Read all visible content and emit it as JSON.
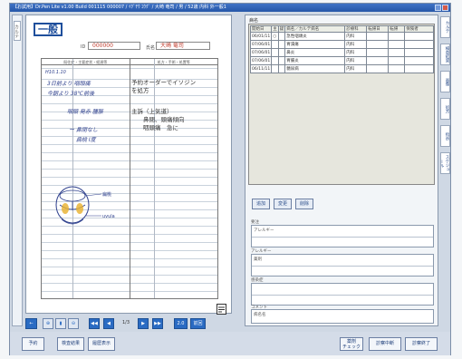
{
  "window": {
    "title": "【お試用】Dr.Pen Lite v1.00 Build 001115 000007 / ｲｸﾞﾁｳ ｺｳｸﾞ / 大崎 竜司 / 男 / 52歳 内科 外一般1"
  },
  "left_tab": {
    "label": "カルテ"
  },
  "chart": {
    "department": "一般",
    "patient_id_label": "ID",
    "patient_id": "000000",
    "name_label": "氏名",
    "patient_name": "大崎 竜司",
    "left_column_header": "既往症・主要症状・経過等",
    "right_column_header": "処方・手術・処置等",
    "handwriting": [
      "H10.1.10",
      "3日前より 咽頭痛",
      "今朝より 38℃前後",
      "咽頭 発赤 腫脹",
      "ー 鼻閉なし",
      "扁桃 Ⅰ度"
    ],
    "typed_lines": [
      "予約オーダーでイソジン",
      "を処方",
      "主訴（上気道）",
      "鼻閉、頭痛傾向",
      "咽頭痛　急に"
    ],
    "sketch_labels": [
      "扁桃",
      "uvula"
    ]
  },
  "nav": {
    "page": "1/3",
    "buttons": [
      "←",
      "⊕",
      "▮",
      "⊖",
      "◀◀",
      "◀",
      "▶",
      "▶▶",
      "2.0",
      "前回"
    ]
  },
  "dx": {
    "label": "病名",
    "headers": [
      "開始日",
      "主",
      "疑",
      "病名／カルテ病名",
      "診療科",
      "転帰日",
      "転帰",
      "保険者"
    ],
    "rows": [
      [
        "06/01/11",
        "○",
        "",
        "急性咽頭炎",
        "内科",
        "",
        "",
        ""
      ],
      [
        "07/06/01",
        "",
        "",
        "胃潰瘍",
        "内科",
        "",
        "",
        ""
      ],
      [
        "07/06/01",
        "",
        "",
        "鼻炎",
        "内科",
        "",
        "",
        ""
      ],
      [
        "07/06/01",
        "",
        "",
        "胃腸炎",
        "内科",
        "",
        "",
        ""
      ],
      [
        "06/11/11",
        "",
        "",
        "糖尿病",
        "内科",
        "",
        "",
        ""
      ]
    ],
    "buttons": [
      "追加",
      "変更",
      "削除"
    ]
  },
  "fields": [
    {
      "label": "要注",
      "sub": "アレルギー"
    },
    {
      "label": "アレルギー",
      "sub": "薬剤"
    },
    {
      "label": "感染症",
      "sub": ""
    },
    {
      "label": "コメント",
      "sub": "病名名"
    }
  ],
  "right_tabs": [
    "カルテ",
    "検査結果",
    "画像",
    "処方",
    "指示",
    "スケジュール"
  ],
  "bottom_bar": {
    "left_buttons": [
      "予約",
      "検査結果",
      "履歴表示"
    ],
    "right_buttons": [
      "薬剤\nチェック",
      "診察中断",
      "診察終了"
    ]
  },
  "colors": {
    "accent": "#2a6bc3",
    "department_border": "#1f4f9c",
    "handwriting": "#2c3e8c"
  }
}
